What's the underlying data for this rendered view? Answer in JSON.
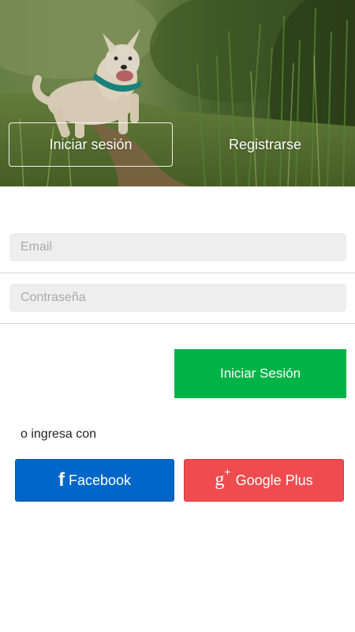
{
  "hero": {
    "image_description_icon": "dog-photo",
    "tabs": {
      "login_label": "Iniciar sesión",
      "register_label": "Registrarse"
    }
  },
  "form": {
    "email_placeholder": "Email",
    "email_value": "",
    "password_placeholder": "Contraseña",
    "password_value": "",
    "submit_label": "Iniciar Sesión"
  },
  "social": {
    "or_text": "o ingresa con",
    "facebook_icon": "f",
    "facebook_label": "Facebook",
    "google_icon": "g",
    "google_icon_plus": "+",
    "google_label": "Google Plus"
  },
  "colors": {
    "primary_green": "#00b347",
    "facebook_blue": "#0066c8",
    "google_red": "#f04c4f",
    "input_background": "#eeeeee"
  }
}
